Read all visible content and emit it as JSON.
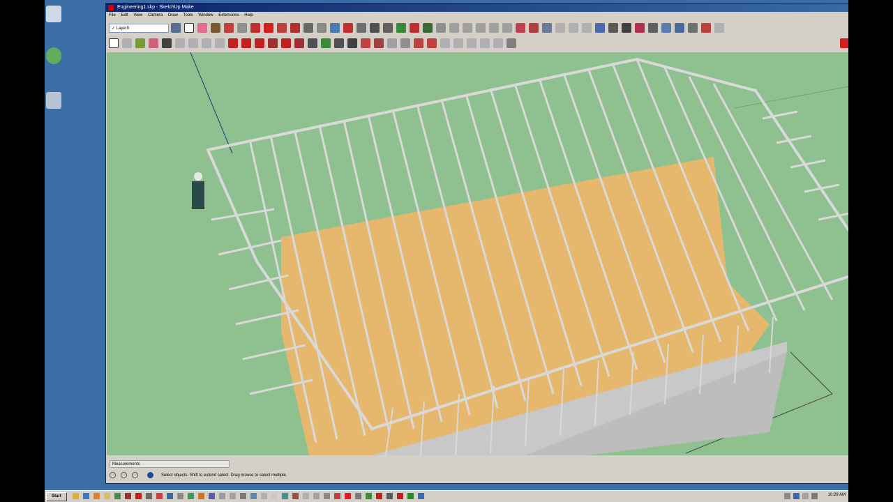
{
  "window": {
    "title": "Engineering1.skp - SketchUp Make"
  },
  "menu": {
    "items": [
      "File",
      "Edit",
      "View",
      "Camera",
      "Draw",
      "Tools",
      "Window",
      "Extensions",
      "Help"
    ]
  },
  "toolbar": {
    "layer_value": "Layer0"
  },
  "statusbar": {
    "measurements_label": "Measurements",
    "status_text": "Select objects. Shift to extend select. Drag mouse to select multiple."
  },
  "taskbar": {
    "start_label": "Start",
    "clock": "10:29 AM"
  },
  "colors": {
    "viewport_bg": "#8fc08f",
    "floor": "#e6b86e",
    "framing": "#d9d9d9",
    "titlebar": "#0a246a"
  }
}
